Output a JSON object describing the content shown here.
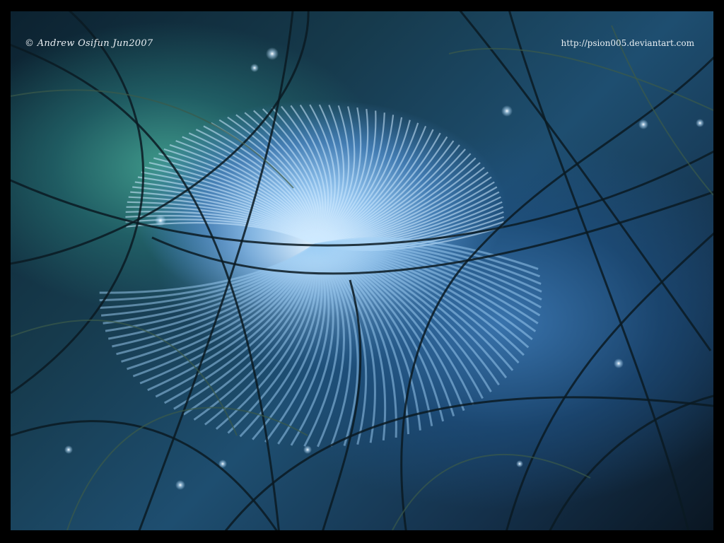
{
  "artwork": {
    "signature": "© Andrew Osifun Jun2007",
    "url": "http://psion005.deviantart.com",
    "palette": {
      "frame": "#000000",
      "glow": "#bfe3ff",
      "blue": "#3f79b0",
      "teal": "#46aa96",
      "dark": "#0a1622"
    }
  }
}
